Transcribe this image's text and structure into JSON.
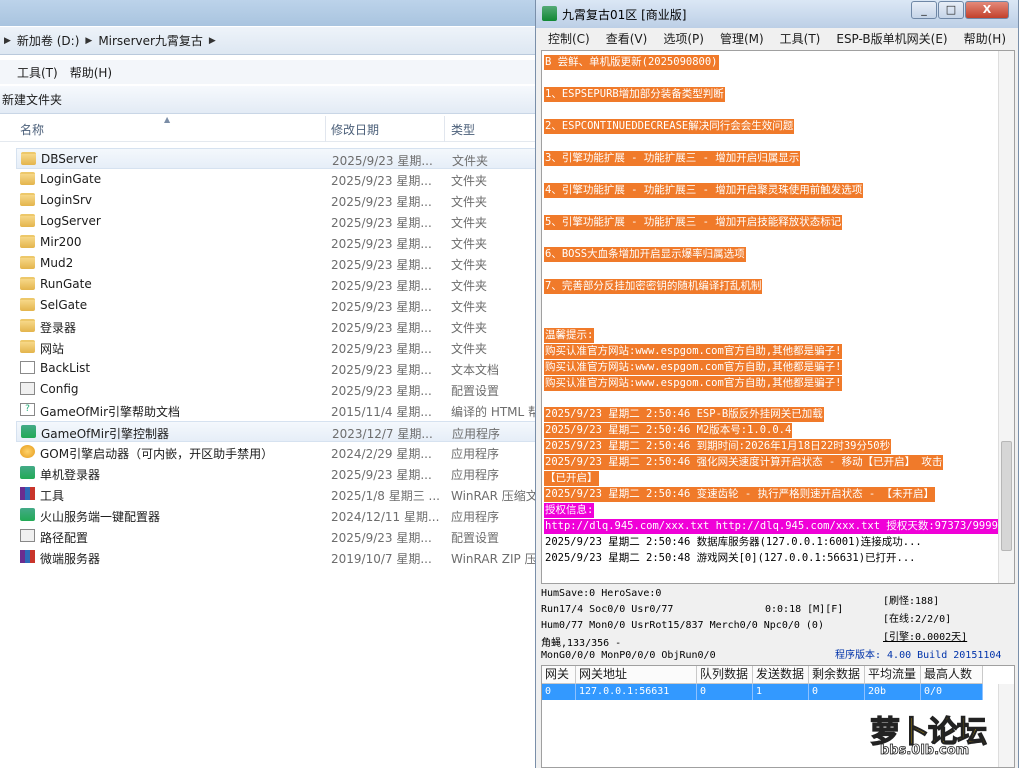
{
  "explorer": {
    "breadcrumb": [
      "新加卷 (D:)",
      "Mirserver九霄复古"
    ],
    "menu": [
      "工具(T)",
      "帮助(H)"
    ],
    "toolbar": {
      "new_folder": "新建文件夹"
    },
    "columns": {
      "name": "名称",
      "date": "修改日期",
      "type": "类型"
    },
    "files": [
      {
        "name": "DBServer",
        "date": "2025/9/23 星期...",
        "type": "文件夹",
        "icon": "folder-icon"
      },
      {
        "name": "LoginGate",
        "date": "2025/9/23 星期...",
        "type": "文件夹",
        "icon": "folder-icon"
      },
      {
        "name": "LoginSrv",
        "date": "2025/9/23 星期...",
        "type": "文件夹",
        "icon": "folder-icon"
      },
      {
        "name": "LogServer",
        "date": "2025/9/23 星期...",
        "type": "文件夹",
        "icon": "folder-icon"
      },
      {
        "name": "Mir200",
        "date": "2025/9/23 星期...",
        "type": "文件夹",
        "icon": "folder-icon"
      },
      {
        "name": "Mud2",
        "date": "2025/9/23 星期...",
        "type": "文件夹",
        "icon": "folder-icon"
      },
      {
        "name": "RunGate",
        "date": "2025/9/23 星期...",
        "type": "文件夹",
        "icon": "folder-icon"
      },
      {
        "name": "SelGate",
        "date": "2025/9/23 星期...",
        "type": "文件夹",
        "icon": "folder-icon"
      },
      {
        "name": "登录器",
        "date": "2025/9/23 星期...",
        "type": "文件夹",
        "icon": "folder-icon"
      },
      {
        "name": "网站",
        "date": "2025/9/23 星期...",
        "type": "文件夹",
        "icon": "folder-icon"
      },
      {
        "name": "BackList",
        "date": "2025/9/23 星期...",
        "type": "文本文档",
        "icon": "text-document-icon"
      },
      {
        "name": "Config",
        "date": "2025/9/23 星期...",
        "type": "配置设置",
        "icon": "config-file-icon"
      },
      {
        "name": "GameOfMir引擎帮助文档",
        "date": "2015/11/4 星期...",
        "type": "编译的 HTML 帮",
        "icon": "help-document-icon"
      },
      {
        "name": "GameOfMir引擎控制器",
        "date": "2023/12/7 星期...",
        "type": "应用程序",
        "icon": "application-icon"
      },
      {
        "name": "GOM引擎启动器（可内嵌，开区助手禁用）",
        "date": "2024/2/29 星期...",
        "type": "应用程序",
        "icon": "gom-launcher-icon"
      },
      {
        "name": "单机登录器",
        "date": "2025/9/23 星期...",
        "type": "应用程序",
        "icon": "application-icon"
      },
      {
        "name": "工具",
        "date": "2025/1/8 星期三 ...",
        "type": "WinRAR 压缩文",
        "icon": "winrar-icon"
      },
      {
        "name": "火山服务端一键配置器",
        "date": "2024/12/11 星期...",
        "type": "应用程序",
        "icon": "application-icon"
      },
      {
        "name": "路径配置",
        "date": "2025/9/23 星期...",
        "type": "配置设置",
        "icon": "config-file-icon"
      },
      {
        "name": "微端服务器",
        "date": "2019/10/7 星期...",
        "type": "WinRAR ZIP 压",
        "icon": "winrar-icon"
      }
    ]
  },
  "server": {
    "title": "九霄复古01区 [商业版]",
    "window_buttons": {
      "minimize": "_",
      "maximize": "□",
      "close": "X"
    },
    "menu": [
      "控制(C)",
      "查看(V)",
      "选项(P)",
      "管理(M)",
      "工具(T)",
      "ESP-B版单机网关(E)",
      "帮助(H)"
    ],
    "log": [
      {
        "text": "B 尝鲜、单机版更新(2025090800)",
        "style": "or"
      },
      {
        "text": "1、ESPSEPURB增加部分装备类型判断",
        "style": "or"
      },
      {
        "text": "2、ESPCONTINUEDDECREASE解决同行会会生效问题",
        "style": "or"
      },
      {
        "text": "3、引擎功能扩展 - 功能扩展三 - 增加开启归属显示",
        "style": "or"
      },
      {
        "text": "4、引擎功能扩展 - 功能扩展三 - 增加开启聚灵珠使用前触发选项",
        "style": "or"
      },
      {
        "text": "5、引擎功能扩展 - 功能扩展三 - 增加开启技能释放状态标记",
        "style": "or"
      },
      {
        "text": "6、BOSS大血条增加开启显示爆率归属选项",
        "style": "or"
      },
      {
        "text": "7、完善部分反挂加密密钥的随机编译打乱机制",
        "style": "or"
      },
      {
        "text": "温馨提示:",
        "style": "or"
      },
      {
        "text": "购买认准官方网站:www.espgom.com官方自助,其他都是骗子!",
        "style": "or"
      },
      {
        "text": "购买认准官方网站:www.espgom.com官方自助,其他都是骗子!",
        "style": "or"
      },
      {
        "text": "购买认准官方网站:www.espgom.com官方自助,其他都是骗子!",
        "style": "or"
      },
      {
        "text": "2025/9/23 星期二 2:50:46 ESP-B版反外挂网关已加载",
        "style": "or"
      },
      {
        "text": "2025/9/23 星期二 2:50:46 M2版本号:1.0.0.4",
        "style": "or"
      },
      {
        "text": "2025/9/23 星期二 2:50:46 到期时间:2026年1月18日22时39分50秒",
        "style": "or"
      },
      {
        "text": "2025/9/23 星期二 2:50:46 强化网关速度计算开启状态 - 移动【已开启】 攻击",
        "style": "or"
      },
      {
        "text": "【已开启】",
        "style": "or"
      },
      {
        "text": "2025/9/23 星期二 2:50:46 变速齿轮 - 执行严格则速开启状态 - 【未开启】",
        "style": "or"
      },
      {
        "text": "授权信息:",
        "style": "mg"
      },
      {
        "text": "http://dlq.945.com/xxx.txt http://dlq.945.com/xxx.txt 授权天数:97373/99999",
        "style": "mg"
      },
      {
        "text": "2025/9/23 星期二 2:50:46 数据库服务器(127.0.0.1:6001)连接成功...",
        "style": "pl"
      },
      {
        "text": "2025/9/23 星期二 2:50:48 游戏网关[0](127.0.0.1:56631)已打开...",
        "style": "pl"
      }
    ],
    "stats": {
      "line1": "HumSave:0 HeroSave:0",
      "line2": "Run17/4 Soc0/0 Usr0/77",
      "line2b": "0:0:18 [M][F]",
      "line3": "Hum0/77 Mon0/0 UsrRot15/837 Merch0/0 Npc0/0 (0)",
      "line4": "角蝇,133/356 -",
      "line5": "MonG0/0/0 MonP0/0/0 ObjRun0/0",
      "right1": "[刷怪:188]",
      "right2": "[在线:2/2/0]",
      "right3": "[引擎:0.0002天]",
      "version": "程序版本: 4.00 Build 20151104"
    },
    "gateway_table": {
      "headers": [
        "网关",
        "网关地址",
        "队列数据",
        "发送数据",
        "剩余数据",
        "平均流量",
        "最高人数"
      ],
      "rows": [
        [
          "0",
          "127.0.0.1:56631",
          "0",
          "1",
          "0",
          "20b",
          "0/0"
        ]
      ]
    }
  },
  "watermark": {
    "main": "萝卜论坛",
    "sub": "bbs.0lb.com"
  }
}
